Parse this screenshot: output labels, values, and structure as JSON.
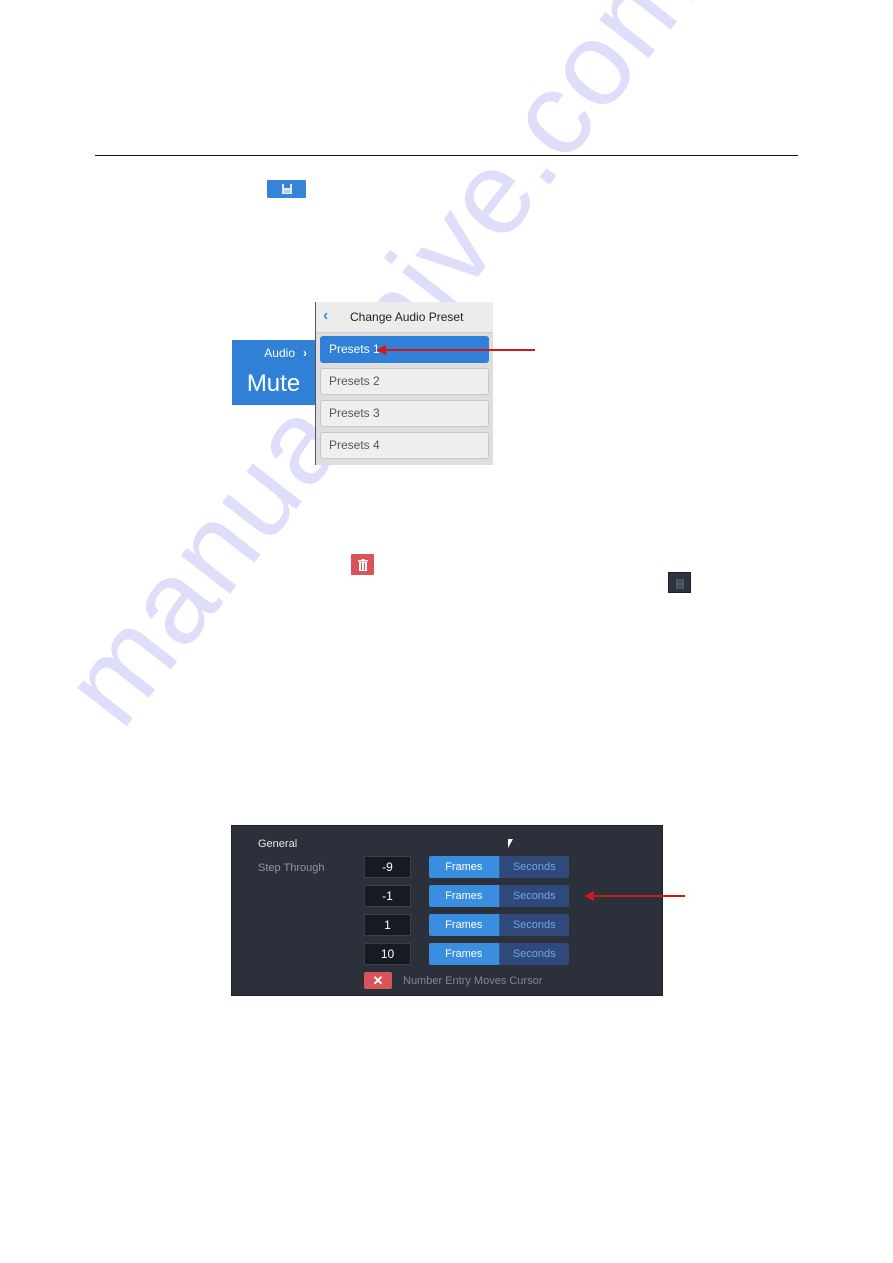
{
  "document": {
    "watermark": "manualshive.com",
    "inline_icons": {
      "save": "save-icon",
      "delete_red": "trash-icon",
      "delete_dark": "trash-icon"
    }
  },
  "audio_preset": {
    "tile": {
      "label": "Audio",
      "chevron": "›",
      "value": "Mute"
    },
    "panel": {
      "back_glyph": "‹",
      "title": "Change Audio Preset",
      "items": [
        {
          "label": "Presets 1",
          "active": true
        },
        {
          "label": "Presets 2",
          "active": false
        },
        {
          "label": "Presets 3",
          "active": false
        },
        {
          "label": "Presets 4",
          "active": false
        }
      ]
    },
    "colors": {
      "accent": "#2f80d6",
      "arrow": "#d01818"
    }
  },
  "general_settings": {
    "section_title": "General",
    "step_through_label": "Step Through",
    "rows": [
      {
        "value": "-9",
        "frames_label": "Frames",
        "seconds_label": "Seconds",
        "selected": "Frames"
      },
      {
        "value": "-1",
        "frames_label": "Frames",
        "seconds_label": "Seconds",
        "selected": "Frames"
      },
      {
        "value": "1",
        "frames_label": "Frames",
        "seconds_label": "Seconds",
        "selected": "Frames"
      },
      {
        "value": "10",
        "frames_label": "Frames",
        "seconds_label": "Seconds",
        "selected": "Frames"
      }
    ],
    "toggle": {
      "glyph": "✕",
      "label": "Number Entry Moves Cursor",
      "state": "off"
    },
    "colors": {
      "background": "#2b303a",
      "accent": "#3a8ee0",
      "off": "#d9535b"
    }
  }
}
